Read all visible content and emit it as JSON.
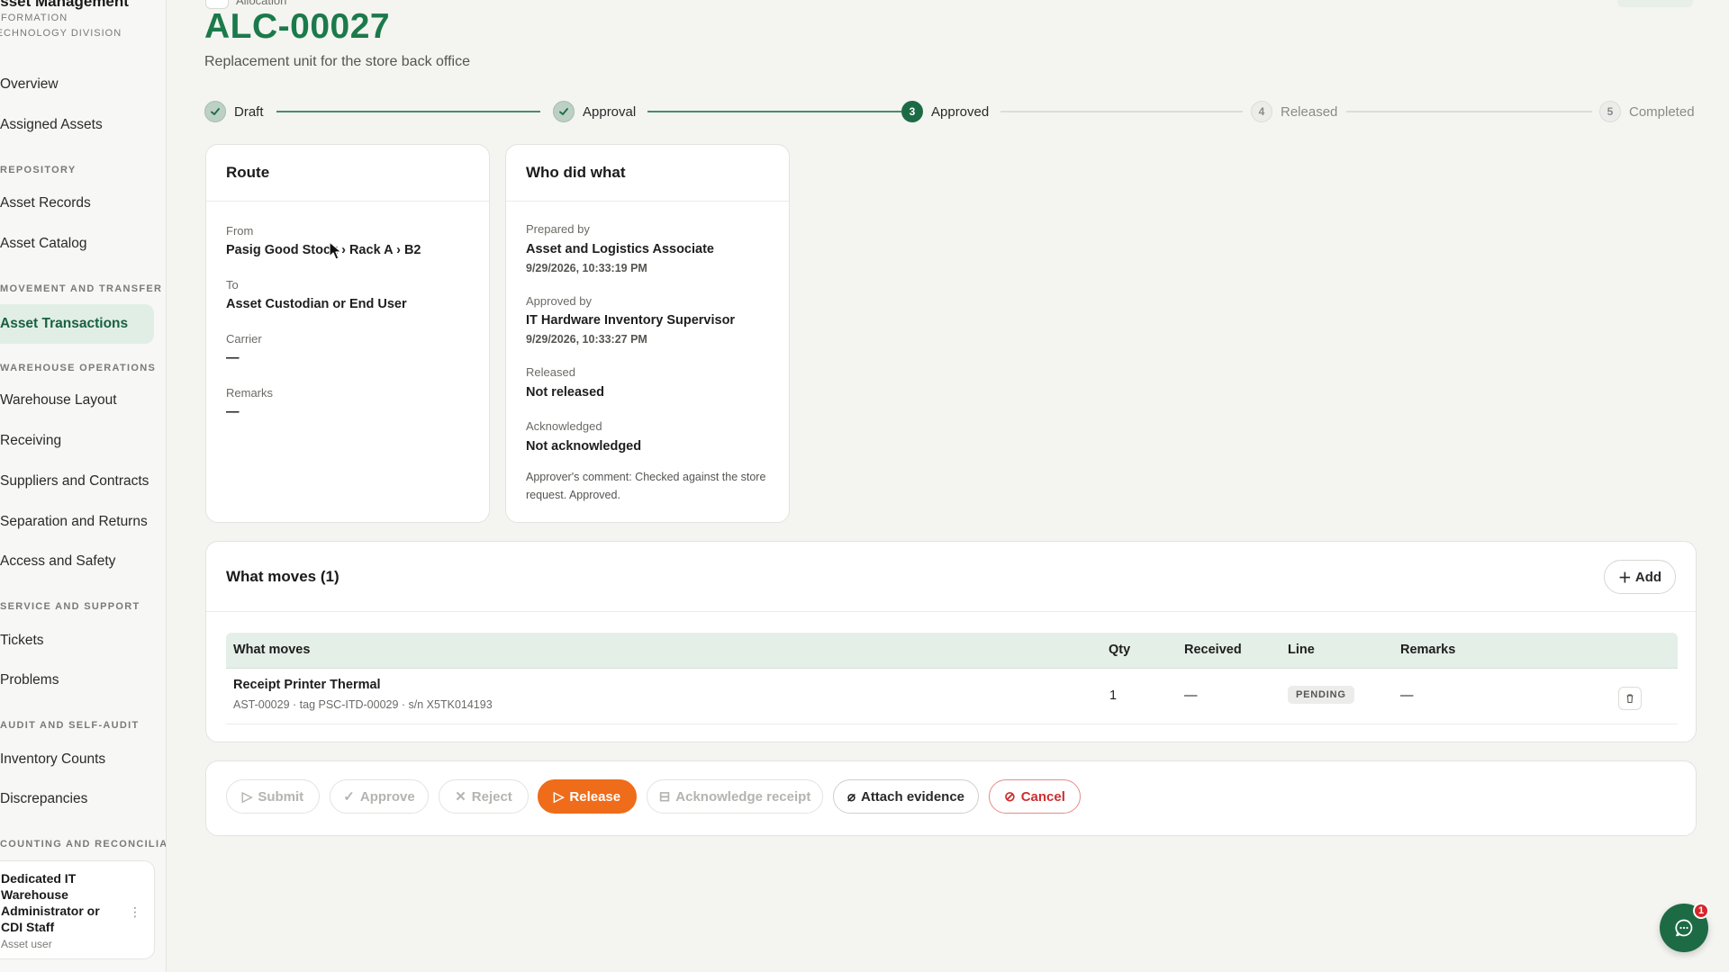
{
  "sidebar": {
    "brand_title": "Asset Management",
    "brand_sub": "Information Technology Division",
    "items": [
      {
        "label": "Overview"
      },
      {
        "label": "Assigned Assets"
      },
      {
        "label": "Asset Records"
      },
      {
        "label": "Asset Catalog"
      },
      {
        "label": "Asset Transactions"
      },
      {
        "label": "Warehouse Layout"
      },
      {
        "label": "Receiving"
      },
      {
        "label": "Suppliers and Contracts"
      },
      {
        "label": "Separation and Returns"
      },
      {
        "label": "Access and Safety"
      },
      {
        "label": "Tickets"
      },
      {
        "label": "Problems"
      },
      {
        "label": "Inventory Counts"
      },
      {
        "label": "Discrepancies"
      }
    ],
    "sections": [
      "Repository",
      "Movement and Transfer",
      "Warehouse Operations",
      "Service and Support",
      "Audit and Self-Audit",
      "Counting and Reconciliation"
    ],
    "user": {
      "name": "Dedicated IT Warehouse Administrator or CDI Staff",
      "role": "Asset user"
    }
  },
  "header": {
    "breadcrumb": "Allocation",
    "title": "ALC-00027",
    "subtitle": "Replacement unit for the store back office"
  },
  "stepper": [
    {
      "num": "1",
      "label": "Draft"
    },
    {
      "num": "2",
      "label": "Approval"
    },
    {
      "num": "3",
      "label": "Approved"
    },
    {
      "num": "4",
      "label": "Released"
    },
    {
      "num": "5",
      "label": "Completed"
    }
  ],
  "route": {
    "title": "Route",
    "from_label": "From",
    "from_value": "Pasig Good Stock › Rack A › B2",
    "to_label": "To",
    "to_value": "Asset Custodian or End User",
    "carrier_label": "Carrier",
    "carrier_value": "—",
    "remarks_label": "Remarks",
    "remarks_value": "—"
  },
  "who": {
    "title": "Who did what",
    "prepared_label": "Prepared by",
    "prepared_value": "Asset and Logistics Associate",
    "prepared_time": "9/29/2026, 10:33:19 PM",
    "approved_label": "Approved by",
    "approved_value": "IT Hardware Inventory Supervisor",
    "approved_time": "9/29/2026, 10:33:27 PM",
    "released_label": "Released",
    "released_value": "Not released",
    "ack_label": "Acknowledged",
    "ack_value": "Not acknowledged",
    "comment": "Approver's comment: Checked against the store request. Approved."
  },
  "moves": {
    "title": "What moves (1)",
    "add_label": "Add",
    "columns": [
      "What moves",
      "Qty",
      "Received",
      "Line",
      "Remarks"
    ],
    "rows": [
      {
        "name": "Receipt Printer Thermal",
        "detail": "AST-00029 · tag PSC-ITD-00029 · s/n X5TK014193",
        "qty": "1",
        "received": "—",
        "line": "PENDING",
        "remarks": "—"
      }
    ]
  },
  "actions": {
    "submit": "Submit",
    "approve": "Approve",
    "reject": "Reject",
    "release": "Release",
    "acknowledge": "Acknowledge receipt",
    "attach": "Attach evidence",
    "cancel": "Cancel"
  },
  "chat": {
    "badge": "1"
  },
  "colors": {
    "brand_green": "#1b7a4a",
    "accent_orange": "#ef6c1a",
    "danger_red": "#cc2f2f",
    "active_nav_bg": "#e1eee6"
  }
}
